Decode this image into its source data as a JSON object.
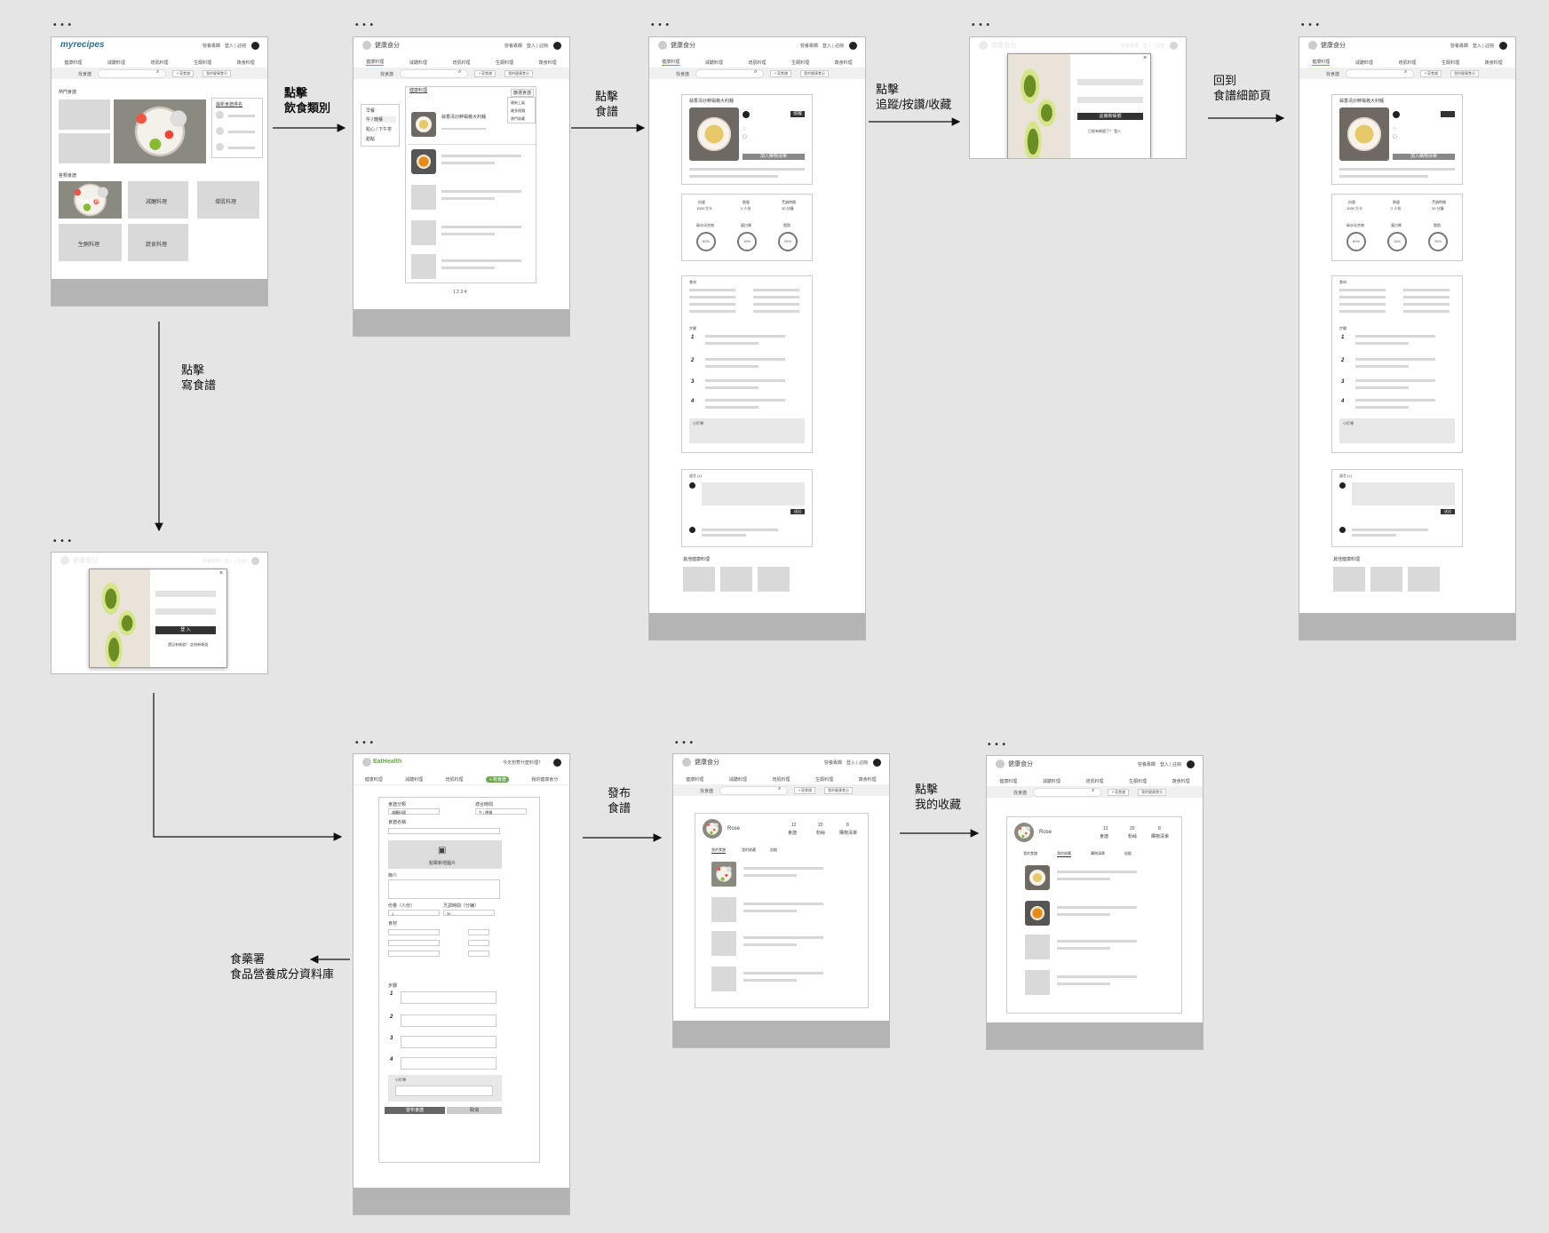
{
  "site": {
    "myrecipes_logo": "myrecipes",
    "brand": "健康食分",
    "eathealth_logo": "EatHealth",
    "header_links": "營養專欄　登入 | 註冊",
    "nav": [
      "健康料理",
      "減醣料理",
      "增肌料理",
      "生酮料理",
      "蔬食料理"
    ],
    "search_label": "找食譜",
    "write_btn": "＋寫食譜",
    "mybox_btn": "我的健康食分",
    "search_placeholder": "今天想煮什麼料理？"
  },
  "home": {
    "popular": "熱門食譜",
    "categories_title": "各類食譜",
    "categories": [
      "健康料理",
      "減醣料理",
      "增肌料理",
      "生酮料理",
      "蔬食料理"
    ],
    "side_title": "最新食譜排名"
  },
  "list": {
    "title": "健康料理",
    "filter_btn": "篩選食譜",
    "menu": [
      "早餐",
      "午 / 晚餐",
      "點心 / 下午茶",
      "甜點"
    ],
    "sort": [
      "最新上架",
      "最多按讚",
      "熱門收藏"
    ],
    "item_title": "蒜香清炒鮮蝦義大利麵",
    "pager": "1 2 3 4"
  },
  "detail": {
    "title": "蒜香清炒鮮蝦義大利麵",
    "follow": "追蹤",
    "stats": [
      "份量",
      "熱量",
      "烹調時間"
    ],
    "values": [
      "1000 大卡",
      "2 人份",
      "30 分鐘"
    ],
    "macros": [
      "碳水化合物",
      "蛋白質",
      "脂肪"
    ],
    "pct": [
      "60%",
      "15%",
      "25%"
    ],
    "ingredients": "食材",
    "steps_title": "步驟",
    "tip": "小叮嚀",
    "comments": "留言 (1)",
    "send": "送出",
    "more": "其他健康料理",
    "add_list": "加入購物清單"
  },
  "login": {
    "submit": "登 入",
    "submit2": "註冊新帳號",
    "footer": "還沒有帳號？ 註冊新帳號",
    "footer2": "已經有帳號了？ 登入"
  },
  "form": {
    "type_label": "食譜分類",
    "type_value": "減醣料理",
    "time_label": "適合時間",
    "time_value": "午 / 晚餐",
    "name_label": "食譜名稱",
    "upload": "點擊新增圖片",
    "intro_label": "簡介",
    "servings_label": "份量（人份）",
    "servings_value": "1",
    "cook_label": "烹調時間（分鐘）",
    "cook_value": "30",
    "ing_label": "食材",
    "steps_label": "步驟",
    "tip_label": "小叮嚀",
    "publish": "發布食譜",
    "cancel": "取消"
  },
  "profile": {
    "name": "Rose",
    "counts": [
      {
        "n": "12",
        "l": "食譜"
      },
      {
        "n": "20",
        "l": "粉絲"
      },
      {
        "n": "8",
        "l": "購物清單"
      }
    ],
    "tabs": [
      "我的食譜",
      "我的收藏",
      "追蹤"
    ],
    "tabs2": [
      "我的食譜",
      "我的收藏",
      "購物清單",
      "追蹤"
    ]
  },
  "arrows": {
    "a1": [
      "點擊",
      "飲食類別"
    ],
    "a2": [
      "點擊",
      "食譜"
    ],
    "a3": [
      "點擊",
      "追蹤/按讚/收藏"
    ],
    "a4": [
      "回到",
      "食譜細節頁"
    ],
    "a5": [
      "點擊",
      "寫食譜"
    ],
    "a6": [
      "發布",
      "食譜"
    ],
    "a7": [
      "點擊",
      "我的收藏"
    ],
    "a8": [
      "食藥署",
      "食品營養成分資料庫"
    ]
  }
}
